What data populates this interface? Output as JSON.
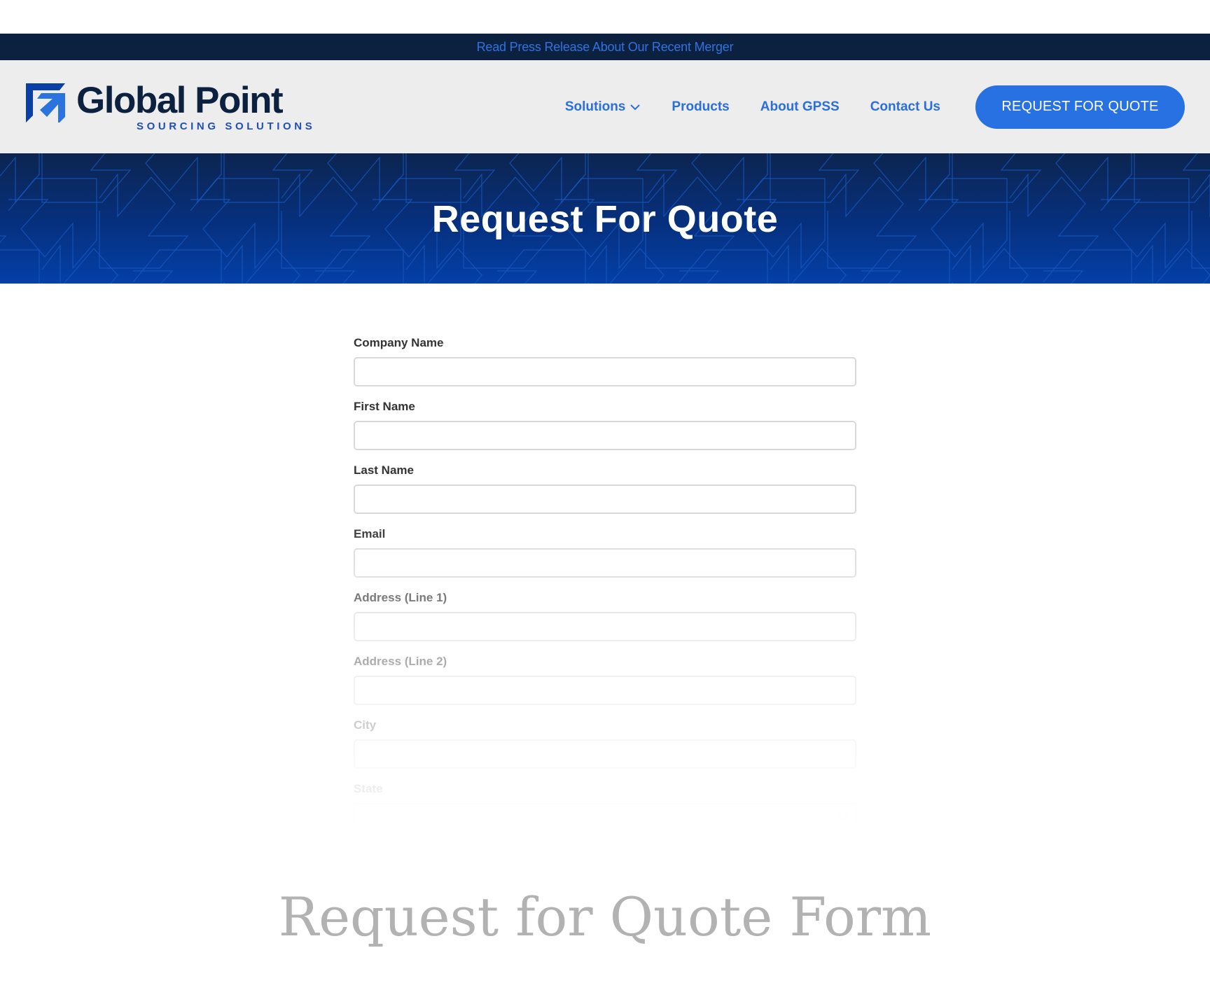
{
  "announcement": {
    "text": "Read Press Release About Our Recent Merger"
  },
  "brand": {
    "name": "Global Point",
    "tagline": "SOURCING SOLUTIONS",
    "colors": {
      "navy": "#0c213f",
      "accent": "#2871e3",
      "link": "#2a6fdc"
    }
  },
  "nav": {
    "items": [
      {
        "label": "Solutions",
        "has_dropdown": true,
        "icon": "chevron-down-icon"
      },
      {
        "label": "Products"
      },
      {
        "label": "About GPSS"
      },
      {
        "label": "Contact Us"
      }
    ],
    "cta_label": "REQUEST FOR QUOTE"
  },
  "hero": {
    "title": "Request For Quote"
  },
  "form": {
    "fields": [
      {
        "label": "Company Name",
        "value": "",
        "type": "text"
      },
      {
        "label": "First Name",
        "value": "",
        "type": "text"
      },
      {
        "label": "Last Name",
        "value": "",
        "type": "text"
      },
      {
        "label": "Email",
        "value": "",
        "type": "email"
      },
      {
        "label": "Address (Line 1)",
        "value": "",
        "type": "text"
      },
      {
        "label": "Address (Line 2)",
        "value": "",
        "type": "text"
      },
      {
        "label": "City",
        "value": "",
        "type": "text"
      },
      {
        "label": "State",
        "value": "",
        "type": "select"
      }
    ]
  },
  "caption": {
    "text": "Request for Quote Form"
  }
}
